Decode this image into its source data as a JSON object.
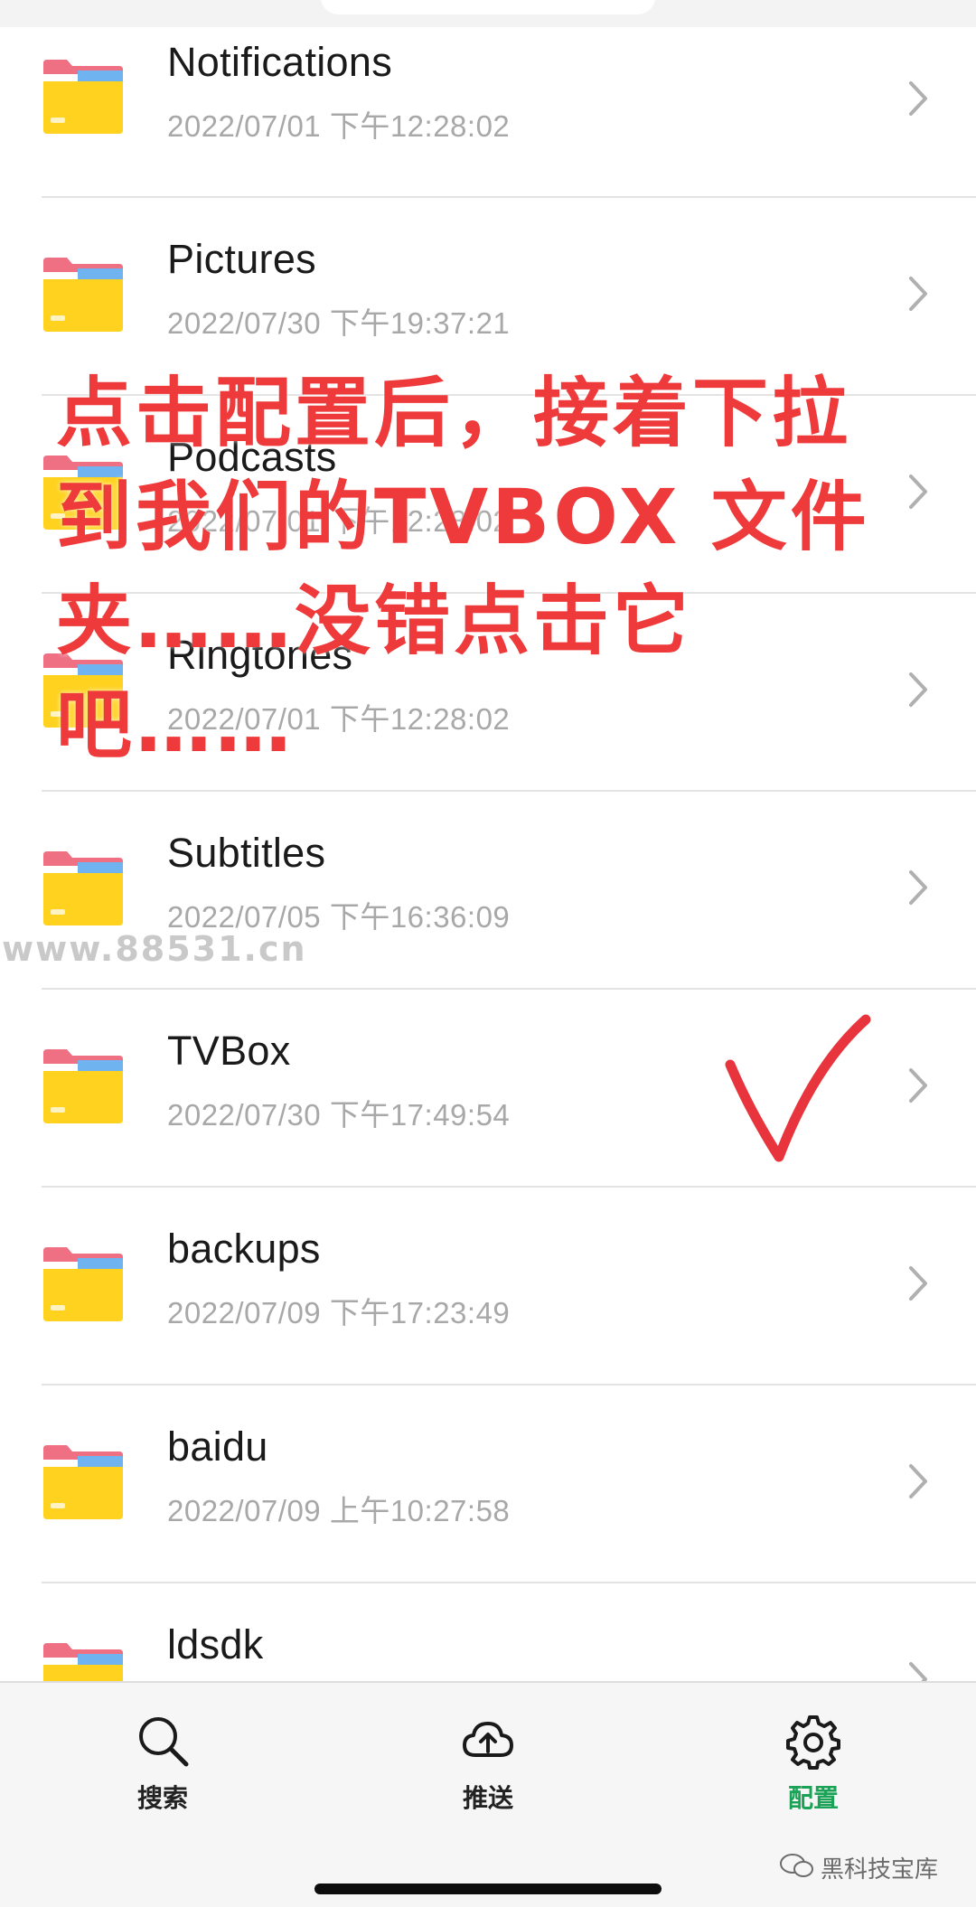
{
  "files": [
    {
      "name": "Notifications",
      "date": "2022/07/01 下午12:28:02"
    },
    {
      "name": "Pictures",
      "date": "2022/07/30 下午19:37:21"
    },
    {
      "name": "Podcasts",
      "date": "2022/07/01 下午12:28:02"
    },
    {
      "name": "Ringtones",
      "date": "2022/07/01 下午12:28:02"
    },
    {
      "name": "Subtitles",
      "date": "2022/07/05 下午16:36:09"
    },
    {
      "name": "TVBox",
      "date": "2022/07/30 下午17:49:54"
    },
    {
      "name": "backups",
      "date": "2022/07/09 下午17:23:49"
    },
    {
      "name": "baidu",
      "date": "2022/07/09 上午10:27:58"
    },
    {
      "name": "ldsdk",
      "date": ""
    }
  ],
  "tabs": {
    "search": "搜索",
    "push": "推送",
    "config": "配置"
  },
  "overlay": {
    "caption_lines": [
      "点击配置后，接着下拉",
      "到我们的TVBOX 文件",
      "夹……没错点击它吧……"
    ],
    "watermark": "www.88531.cn",
    "brand": "黑科技宝库"
  },
  "colors": {
    "accent": "#1aa356",
    "caption": "#ee3a3a",
    "check": "#e8353d"
  }
}
